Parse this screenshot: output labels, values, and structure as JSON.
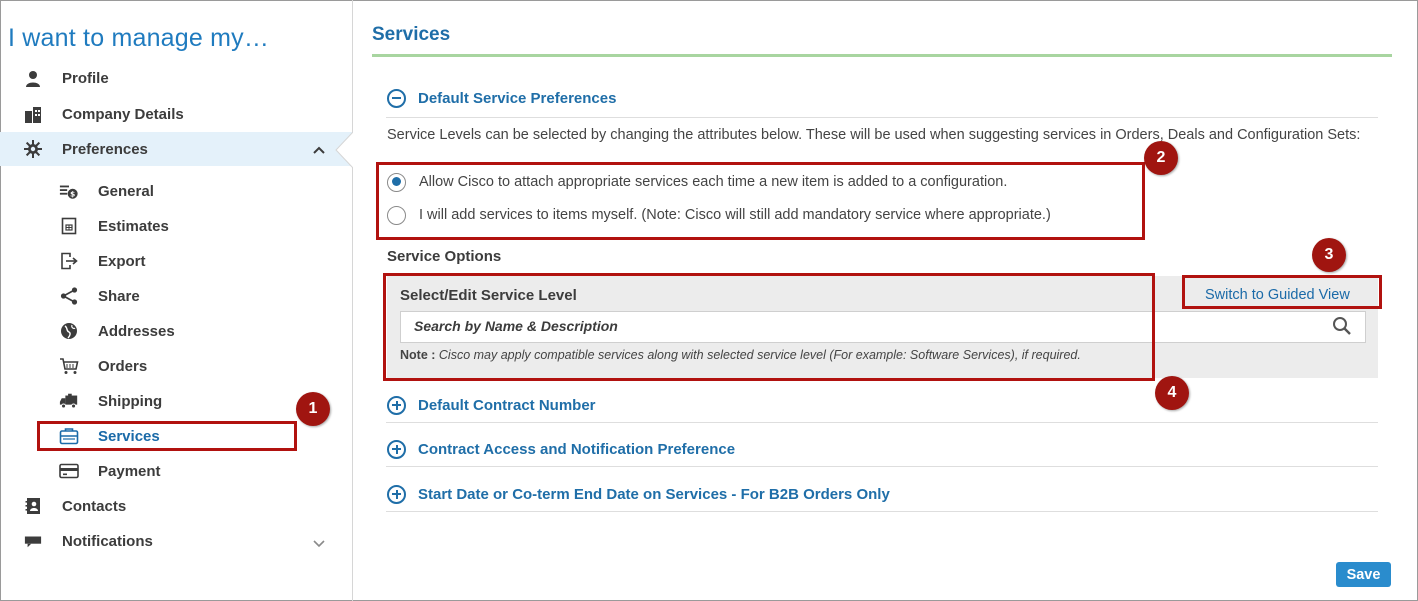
{
  "sidebar": {
    "title": "I want to manage my…",
    "items": [
      {
        "label": "Profile",
        "icon": "person-icon"
      },
      {
        "label": "Company Details",
        "icon": "buildings-icon"
      },
      {
        "label": "Preferences",
        "icon": "gear-icon",
        "expanded": true
      },
      {
        "label": "Contacts",
        "icon": "address-book-icon"
      },
      {
        "label": "Notifications",
        "icon": "message-icon"
      }
    ],
    "preferences_sub": [
      {
        "label": "General",
        "icon": "general-settings-icon"
      },
      {
        "label": "Estimates",
        "icon": "estimate-doc-icon"
      },
      {
        "label": "Export",
        "icon": "export-icon"
      },
      {
        "label": "Share",
        "icon": "share-icon"
      },
      {
        "label": "Addresses",
        "icon": "globe-icon"
      },
      {
        "label": "Orders",
        "icon": "cart-icon"
      },
      {
        "label": "Shipping",
        "icon": "truck-icon"
      },
      {
        "label": "Services",
        "icon": "services-icon",
        "current": true
      },
      {
        "label": "Payment",
        "icon": "card-icon"
      }
    ]
  },
  "main": {
    "title": "Services",
    "default_service_preferences": {
      "heading": "Default Service Preferences",
      "description": "Service Levels can be selected by changing the attributes below. These will be used when suggesting services in Orders, Deals and Configuration Sets:",
      "options": [
        {
          "label": "Allow Cisco to attach appropriate services each time a new item is added to a configuration.",
          "selected": true
        },
        {
          "label": "I will add services to items myself. (Note: Cisco will still add mandatory service where appropriate.)",
          "selected": false
        }
      ]
    },
    "service_options": {
      "heading": "Service Options",
      "panel_label": "Select/Edit Service Level",
      "guided_view_link": "Switch to Guided View",
      "search_placeholder": "Search by Name & Description",
      "note_label": "Note :",
      "note_text": "Cisco may apply compatible services along with selected service level (For example: Software Services), if required."
    },
    "collapsed_sections": [
      "Default Contract Number",
      "Contract Access and Notification Preference",
      "Start Date or Co-term End Date on Services - For B2B Orders Only"
    ],
    "save_label": "Save"
  },
  "callouts": [
    "1",
    "2",
    "3",
    "4"
  ],
  "colors": {
    "accent_blue": "#1f6ea8",
    "title_blue": "#1f7bbf",
    "callout_red": "#b1120f",
    "save_button": "#2a8ccd",
    "panel_grey": "#ececec",
    "title_rule_green": "#a8d5a0"
  }
}
